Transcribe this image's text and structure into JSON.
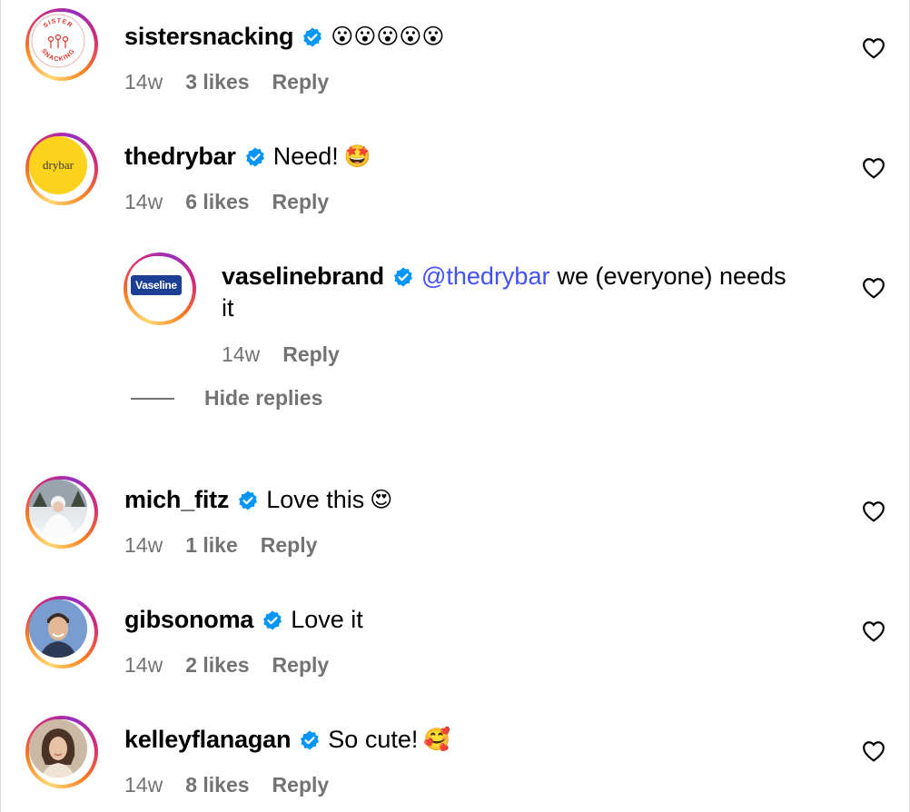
{
  "comments": [
    {
      "username": "sistersnacking",
      "text": "",
      "emoji": "😮😮😮😮😮",
      "time": "14w",
      "likes": "3 likes",
      "reply": "Reply",
      "avatar_icon": "sister-snacking-logo",
      "logo_text": "SISTER SNACKING"
    },
    {
      "username": "thedrybar",
      "text": "Need!",
      "emoji": "🤩",
      "time": "14w",
      "likes": "6 likes",
      "reply": "Reply",
      "avatar_icon": "drybar-logo",
      "logo_text": "drybar"
    },
    {
      "username": "mich_fitz",
      "text": "Love this",
      "emoji": "😍",
      "time": "14w",
      "likes": "1 like",
      "reply": "Reply",
      "avatar_icon": "profile-photo"
    },
    {
      "username": "gibsonoma",
      "text": "Love it",
      "emoji": "",
      "time": "14w",
      "likes": "2 likes",
      "reply": "Reply",
      "avatar_icon": "profile-photo"
    },
    {
      "username": "kelleyflanagan",
      "text": "So cute!",
      "emoji": "🥰",
      "time": "14w",
      "likes": "8 likes",
      "reply": "Reply",
      "avatar_icon": "profile-photo"
    }
  ],
  "reply": {
    "username": "vaselinebrand",
    "mention": "@thedrybar",
    "text_line1": "we (everyone) needs",
    "text_line2": "it",
    "time": "14w",
    "reply": "Reply",
    "avatar_icon": "vaseline-logo",
    "logo_text": "Vaseline"
  },
  "hide_replies": "Hide replies",
  "colors": {
    "muted": "#737373",
    "verified": "#0095f6",
    "mention": "#4150f7"
  }
}
